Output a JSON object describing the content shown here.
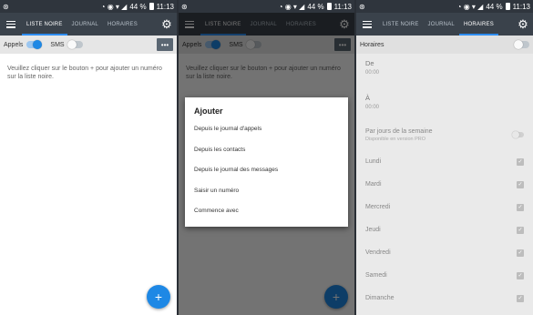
{
  "status_bar": {
    "time": "11:13",
    "battery": "44 %"
  },
  "tabs": [
    "LISTE NOIRE",
    "JOURNAL",
    "HORAIRES"
  ],
  "screen1": {
    "calls_label": "Appels",
    "sms_label": "SMS",
    "more_label": "•••",
    "empty_message": "Veuillez cliquer sur le bouton + pour ajouter un numéro sur la liste noire.",
    "fab_label": "+"
  },
  "screen2": {
    "dialog_title": "Ajouter",
    "items": [
      "Depuis le journal d'appels",
      "Depuis les contacts",
      "Depuis le journal des messages",
      "Saisir un numéro",
      "Commence avec"
    ]
  },
  "screen3": {
    "header": "Horaires",
    "from_label": "De",
    "from_value": "00:00",
    "to_label": "À",
    "to_value": "00:00",
    "days_label": "Par jours de la semaine",
    "days_sub": "Disponible en version PRO",
    "days": [
      "Lundi",
      "Mardi",
      "Mercredi",
      "Jeudi",
      "Vendredi",
      "Samedi",
      "Dimanche"
    ]
  }
}
